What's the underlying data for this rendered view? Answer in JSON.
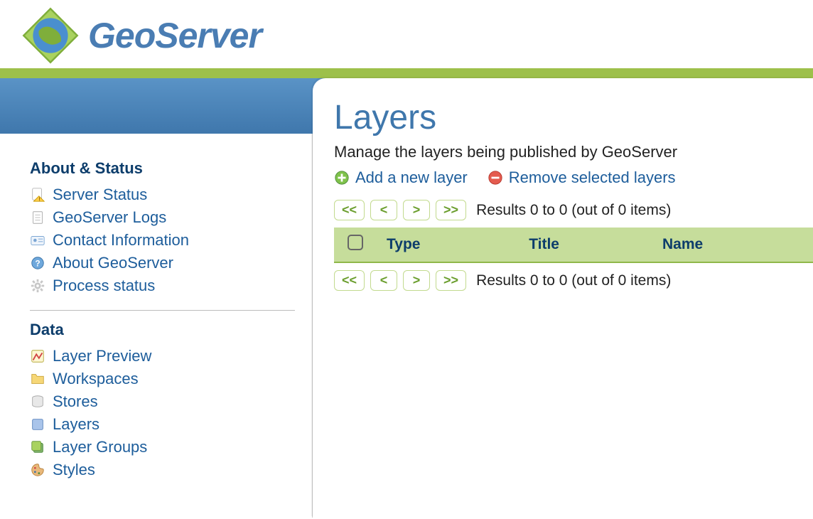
{
  "brand": "GeoServer",
  "sidebar": {
    "sections": [
      {
        "title": "About & Status",
        "items": [
          {
            "label": "Server Status",
            "icon": "page-warning-icon"
          },
          {
            "label": "GeoServer Logs",
            "icon": "document-icon"
          },
          {
            "label": "Contact Information",
            "icon": "id-card-icon"
          },
          {
            "label": "About GeoServer",
            "icon": "help-icon"
          },
          {
            "label": "Process status",
            "icon": "gear-icon"
          }
        ]
      },
      {
        "title": "Data",
        "items": [
          {
            "label": "Layer Preview",
            "icon": "preview-icon"
          },
          {
            "label": "Workspaces",
            "icon": "folder-icon"
          },
          {
            "label": "Stores",
            "icon": "database-icon"
          },
          {
            "label": "Layers",
            "icon": "layer-icon"
          },
          {
            "label": "Layer Groups",
            "icon": "layer-group-icon"
          },
          {
            "label": "Styles",
            "icon": "palette-icon"
          }
        ]
      }
    ]
  },
  "main": {
    "title": "Layers",
    "subtitle": "Manage the layers being published by GeoServer",
    "actions": {
      "add": "Add a new layer",
      "remove": "Remove selected layers"
    },
    "pager": {
      "first": "<<",
      "prev": "<",
      "next": ">",
      "last": ">>",
      "status": "Results 0 to 0 (out of 0 items)"
    },
    "table": {
      "columns": [
        "Type",
        "Title",
        "Name"
      ]
    }
  }
}
